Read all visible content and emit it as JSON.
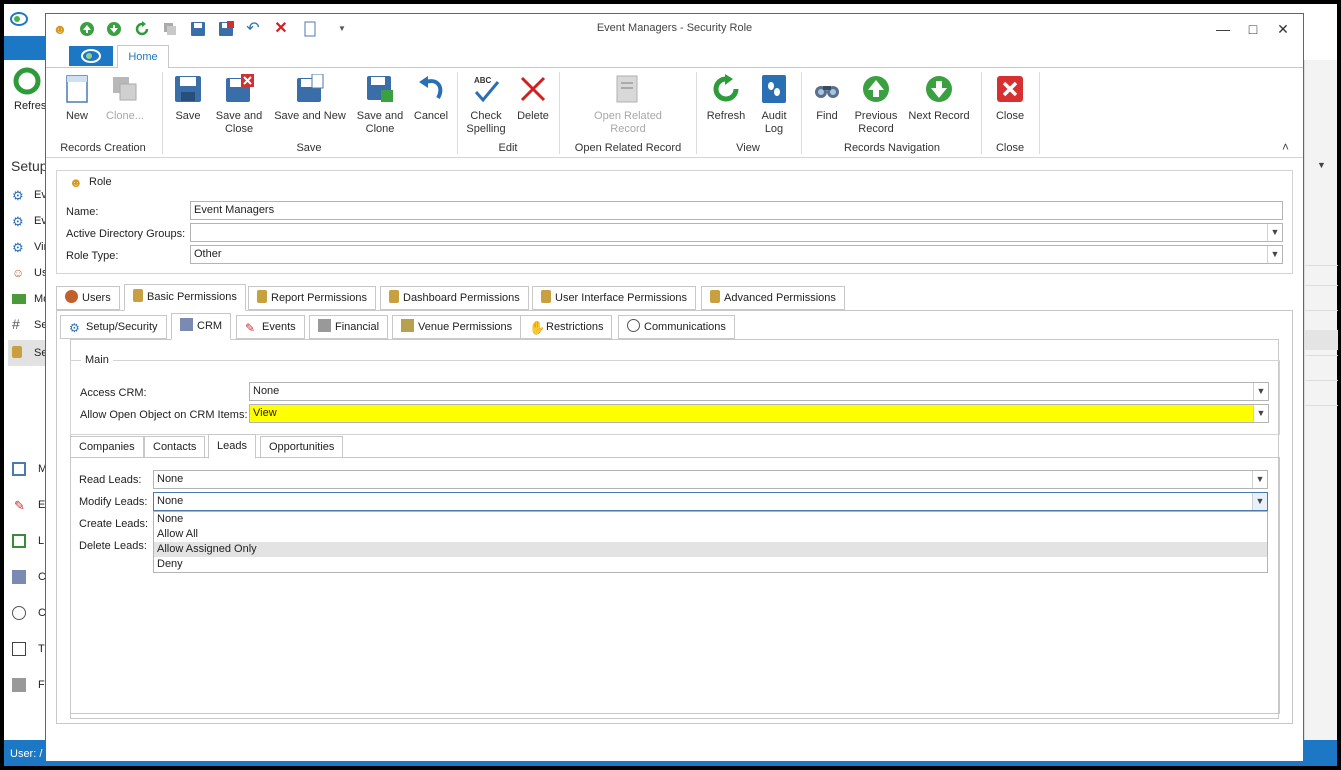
{
  "background": {
    "left_partial": {
      "refresh": "Refres",
      "setup": "Setup"
    },
    "status": "User: /",
    "sidebar_items": [
      "Ev",
      "Ev",
      "Vir",
      "Us",
      "Mo",
      "Se",
      "Se"
    ],
    "nav_items": [
      "M",
      "E",
      "L",
      "C",
      "C",
      "T",
      "F"
    ]
  },
  "window": {
    "title": "Event Managers - Security Role",
    "minimize": "—",
    "maximize": "□",
    "close": "✕"
  },
  "ribbon": {
    "home_tab": "Home",
    "groups": {
      "records_creation": "Records Creation",
      "save": "Save",
      "edit": "Edit",
      "open_related": "Open Related Record",
      "view": "View",
      "records_navigation": "Records Navigation",
      "close": "Close"
    },
    "buttons": {
      "new": "New",
      "clone": "Clone...",
      "save": "Save",
      "save_and_close_1": "Save and",
      "save_and_close_2": "Close",
      "save_and_new": "Save and New",
      "save_and_clone_1": "Save and",
      "save_and_clone_2": "Clone",
      "cancel": "Cancel",
      "check_spelling_1": "Check",
      "check_spelling_2": "Spelling",
      "delete": "Delete",
      "open_related_1": "Open Related",
      "open_related_2": "Record",
      "refresh": "Refresh",
      "audit_log_1": "Audit",
      "audit_log_2": "Log",
      "find": "Find",
      "previous_record_1": "Previous",
      "previous_record_2": "Record",
      "next_record": "Next Record",
      "close": "Close"
    },
    "collapse": "˄"
  },
  "role": {
    "section": "Role",
    "name_label": "Name:",
    "name_value": "Event Managers",
    "ad_groups_label": "Active Directory Groups:",
    "ad_groups_value": "",
    "role_type_label": "Role Type:",
    "role_type_value": "Other"
  },
  "tabs": {
    "users": "Users",
    "basic_permissions": "Basic Permissions",
    "report_permissions": "Report Permissions",
    "dashboard_permissions": "Dashboard Permissions",
    "ui_permissions": "User Interface Permissions",
    "advanced_permissions": "Advanced Permissions"
  },
  "subtabs": {
    "setup_security": "Setup/Security",
    "crm": "CRM",
    "events": "Events",
    "financial": "Financial",
    "venue_permissions": "Venue Permissions",
    "restrictions": "Restrictions",
    "communications": "Communications"
  },
  "main": {
    "section": "Main",
    "access_crm_label": "Access CRM:",
    "access_crm_value": "None",
    "allow_open_label": "Allow Open Object on CRM Items:",
    "allow_open_value": "View",
    "highlight_color": "#ffff00"
  },
  "crm_tabs": {
    "companies": "Companies",
    "contacts": "Contacts",
    "leads": "Leads",
    "opportunities": "Opportunities"
  },
  "leads": {
    "read_label": "Read Leads:",
    "read_value": "None",
    "modify_label": "Modify Leads:",
    "modify_value": "None",
    "create_label": "Create Leads:",
    "delete_label": "Delete Leads:"
  },
  "dropdown_options": [
    "None",
    "Allow All",
    "Allow Assigned Only",
    "Deny"
  ],
  "dropdown_highlighted": "Allow Assigned Only",
  "colors": {
    "accent": "#1c78c4"
  }
}
